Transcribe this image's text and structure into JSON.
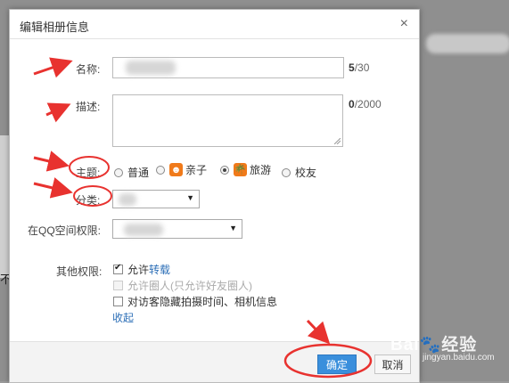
{
  "dialog": {
    "title": "编辑相册信息",
    "close_glyph": "×"
  },
  "form": {
    "name_label": "名称:",
    "name_counter_used": "5",
    "name_counter_max": "/30",
    "desc_label": "描述:",
    "desc_counter_used": "0",
    "desc_counter_max": "/2000",
    "theme_label": "主题:",
    "themes": [
      {
        "label": "普通",
        "selected": false,
        "icon": "",
        "has_icon": false
      },
      {
        "label": "亲子",
        "selected": false,
        "icon": "child-face-icon",
        "has_icon": true
      },
      {
        "label": "旅游",
        "selected": true,
        "icon": "palm-tree-icon",
        "has_icon": true
      },
      {
        "label": "校友",
        "selected": false,
        "icon": "",
        "has_icon": false
      }
    ],
    "category_label": "分类:",
    "qq_perm_label": "在QQ空间权限:",
    "other_perm_label": "其他权限:",
    "allow_prefix": "允许",
    "allow_link": "转载",
    "allow_circle": "允许圈人(只允许好友圈人)",
    "hide_info": "对访客隐藏拍摄时间、相机信息",
    "collapse": "收起"
  },
  "buttons": {
    "ok": "确定",
    "cancel": "取消"
  },
  "background": {
    "fragment": "不"
  },
  "watermark": {
    "brand": "Bai",
    "brand2": "经验",
    "url": "jingyan.baidu.com"
  },
  "colors": {
    "accent": "#3a8fdc",
    "annotation": "#e8322f",
    "theme_icon": "#f07a1a"
  }
}
